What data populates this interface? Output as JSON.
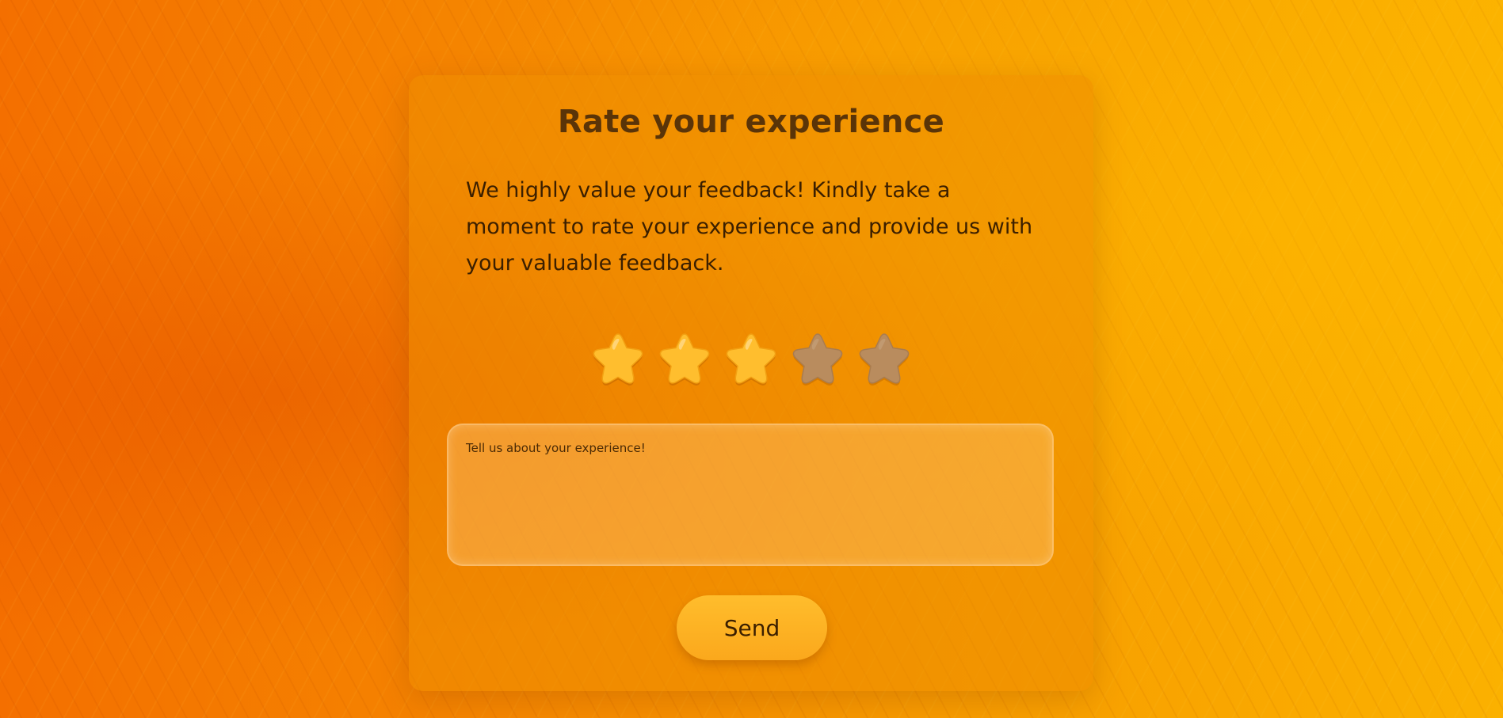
{
  "card": {
    "title": "Rate your experience",
    "description": "We highly value your feedback! Kindly take a moment to rate your experience and provide us with your valuable feedback."
  },
  "rating": {
    "value": 3,
    "max": 5,
    "filled_color": "#ffbe2e",
    "empty_color": "#b98c5e"
  },
  "feedback": {
    "value": "",
    "placeholder": "Tell us about your experience!"
  },
  "actions": {
    "send_label": "Send"
  },
  "colors": {
    "title": "#5a3408",
    "text": "#3b1f00",
    "button": "#ffb426"
  }
}
